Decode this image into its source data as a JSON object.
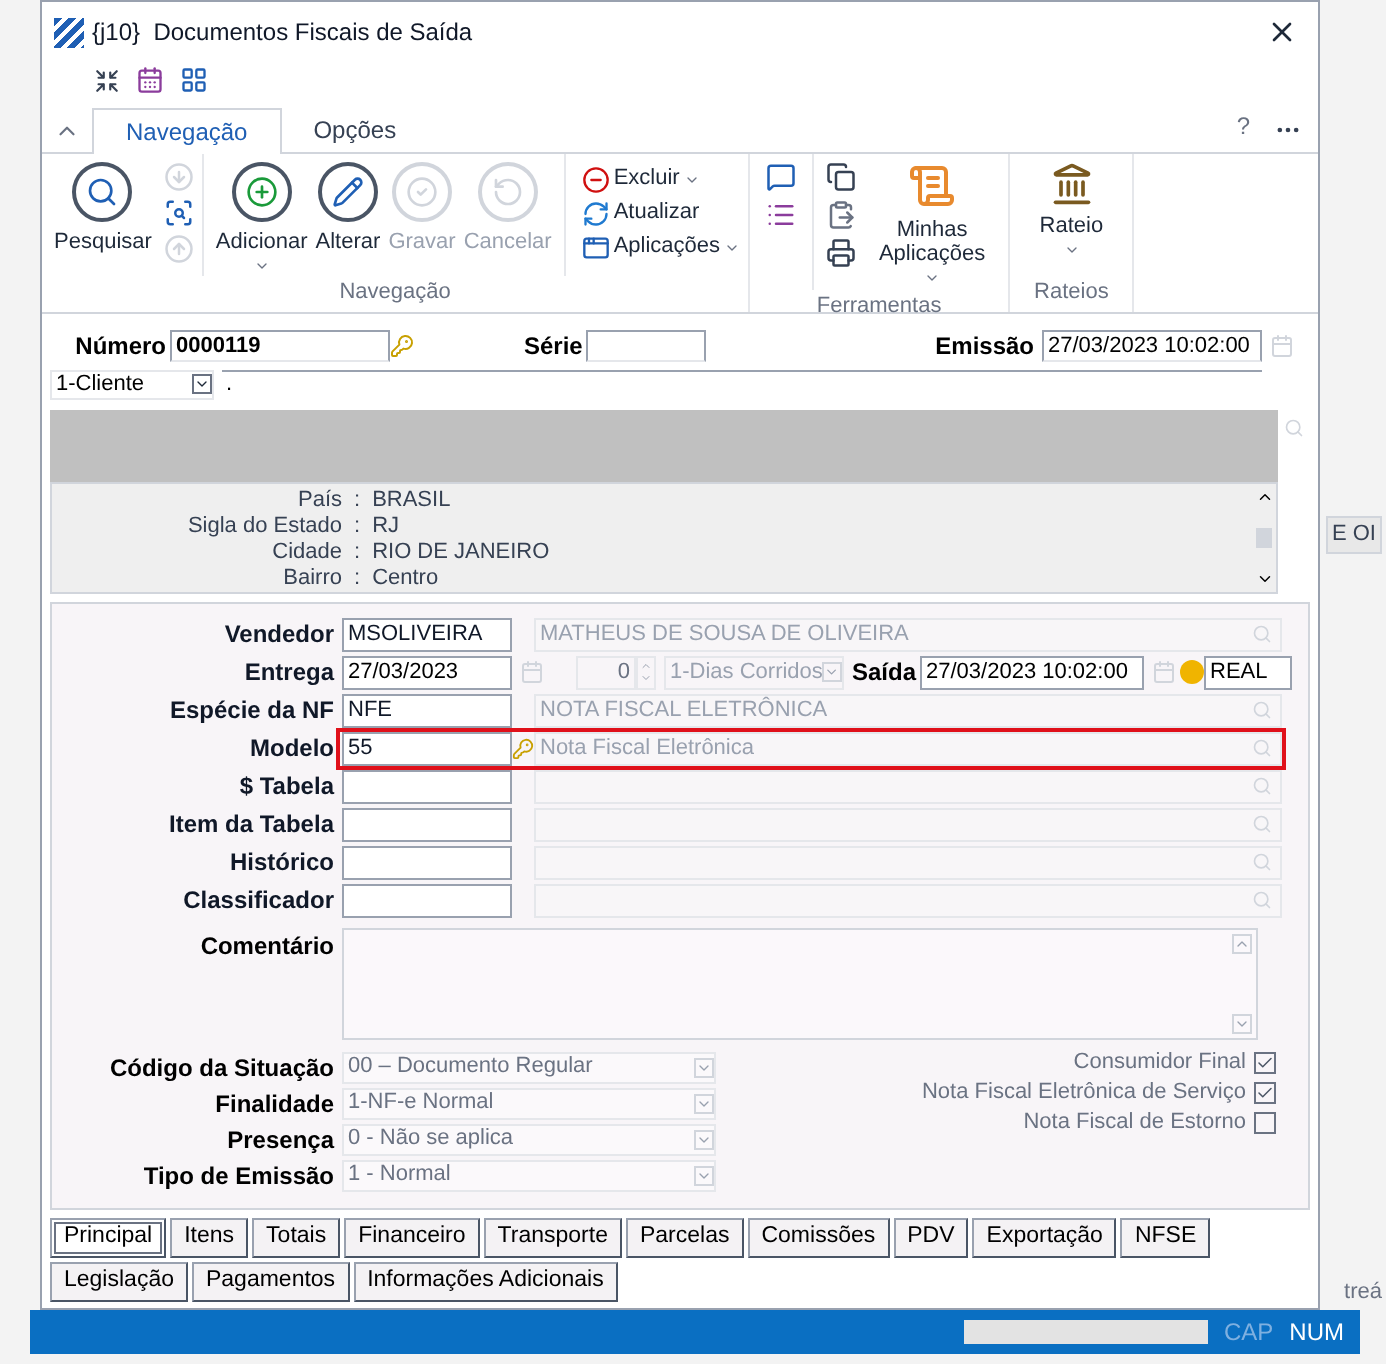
{
  "window": {
    "title": "{j10}  Documentos Fiscais de Saída"
  },
  "ribbon": {
    "tabs": [
      {
        "label": "Navegação",
        "selected": true
      },
      {
        "label": "Opções",
        "selected": false
      }
    ],
    "help": "?",
    "groups": [
      {
        "label": "Navegação",
        "buttons": [
          {
            "label": "Pesquisar",
            "disabled": false,
            "dropdown": false
          },
          {
            "label": "Adicionar",
            "disabled": false,
            "dropdown": true
          },
          {
            "label": "Alterar",
            "disabled": false,
            "dropdown": false
          },
          {
            "label": "Gravar",
            "disabled": true,
            "dropdown": false
          },
          {
            "label": "Cancelar",
            "disabled": true,
            "dropdown": false
          }
        ],
        "small": [
          {
            "label": "Excluir",
            "dropdown": true
          },
          {
            "label": "Atualizar",
            "dropdown": false
          },
          {
            "label": "Aplicações",
            "dropdown": true
          }
        ]
      },
      {
        "label": "Ferramentas",
        "buttons": [
          {
            "label": "Minhas Aplicações",
            "disabled": false,
            "dropdown": true
          }
        ]
      },
      {
        "label": "Rateios",
        "buttons": [
          {
            "label": "Rateio",
            "disabled": false,
            "dropdown": true
          }
        ]
      }
    ]
  },
  "header": {
    "numero": {
      "label": "Número",
      "value": "0000119"
    },
    "serie": {
      "label": "Série"
    },
    "emissao": {
      "label": "Emissão",
      "value": "27/03/2023 10:02:00"
    }
  },
  "client": {
    "type": "1-Cliente",
    "value": "."
  },
  "address": [
    {
      "label": "País",
      "separator": ":",
      "value": "BRASIL"
    },
    {
      "label": "Sigla do Estado",
      "separator": ":",
      "value": "RJ"
    },
    {
      "label": "Cidade",
      "separator": ":",
      "value": "RIO DE JANEIRO"
    },
    {
      "label": "Bairro",
      "separator": ":",
      "value": "Centro"
    }
  ],
  "fields": [
    {
      "kind": "lookup",
      "label": "Vendedor",
      "code": "MSOLIVEIRA",
      "description": "MATHEUS DE SOUSA DE OLIVEIRA",
      "highlighted": false,
      "key": false
    },
    {
      "kind": "dates",
      "label": "Entrega",
      "code": "27/03/2023",
      "days": "0",
      "days_type": "1-Dias Corridos",
      "saida_label": "Saída",
      "saida": "27/03/2023 10:02:00",
      "currency": "REAL"
    },
    {
      "kind": "lookup",
      "label": "Espécie da NF",
      "code": "NFE",
      "description": "NOTA FISCAL ELETRÔNICA",
      "highlighted": false,
      "key": false
    },
    {
      "kind": "lookup",
      "label": "Modelo",
      "code": "55",
      "description": "Nota Fiscal Eletrônica",
      "highlighted": true,
      "key": true
    },
    {
      "kind": "lookup",
      "label": "$ Tabela",
      "highlighted": false,
      "key": false
    },
    {
      "kind": "lookup",
      "label": "Item da Tabela",
      "highlighted": false,
      "key": false
    },
    {
      "kind": "lookup",
      "label": "Histórico",
      "highlighted": false,
      "key": false
    },
    {
      "kind": "lookup",
      "label": "Classificador",
      "highlighted": false,
      "key": false
    },
    {
      "kind": "memo",
      "label": "Comentário"
    }
  ],
  "selects": [
    {
      "label": "Código da Situação",
      "value": "00 – Documento Regular",
      "disabled": true
    },
    {
      "label": "Finalidade",
      "value": "1-NF-e Normal",
      "disabled": true
    },
    {
      "label": "Presença",
      "value": "0 - Não se aplica",
      "disabled": true
    },
    {
      "label": "Tipo de Emissão",
      "value": "1 - Normal",
      "disabled": true
    }
  ],
  "checkboxes": [
    {
      "label": "Consumidor Final",
      "checked": true
    },
    {
      "label": "Nota Fiscal Eletrônica de Serviço",
      "checked": true
    },
    {
      "label": "Nota Fiscal de Estorno",
      "checked": false
    }
  ],
  "bottom_tabs": [
    {
      "label": "Principal",
      "selected": true
    },
    {
      "label": "Itens",
      "selected": false
    },
    {
      "label": "Totais",
      "selected": false
    },
    {
      "label": "Financeiro",
      "selected": false
    },
    {
      "label": "Transporte",
      "selected": false
    },
    {
      "label": "Parcelas",
      "selected": false
    },
    {
      "label": "Comissões",
      "selected": false
    },
    {
      "label": "PDV",
      "selected": false
    },
    {
      "label": "Exportação",
      "selected": false
    },
    {
      "label": "NFSE",
      "selected": false
    },
    {
      "label": "Legislação",
      "selected": false
    },
    {
      "label": "Pagamentos",
      "selected": false
    },
    {
      "label": "Informações Adicionais",
      "selected": false
    }
  ],
  "background": {
    "fragment_1": "E OI",
    "fragment_2": "treá"
  },
  "status_bar": {
    "indicators": [
      {
        "label": "CAP",
        "on": false
      },
      {
        "label": "NUM",
        "on": true
      }
    ]
  }
}
